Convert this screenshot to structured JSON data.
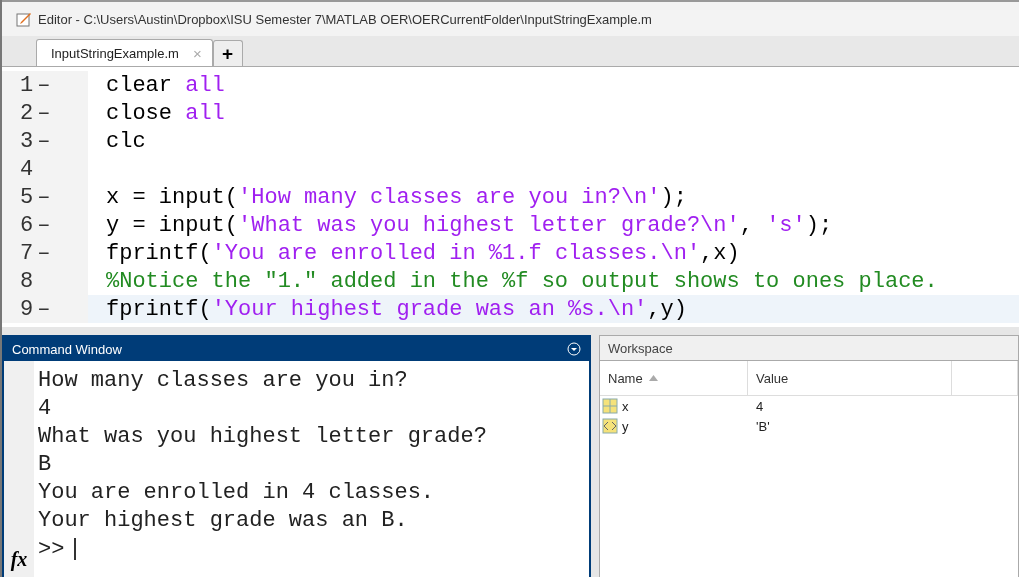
{
  "window": {
    "title": "Editor - C:\\Users\\Austin\\Dropbox\\ISU Semester 7\\MATLAB OER\\OERCurrentFolder\\InputStringExample.m"
  },
  "tabs": [
    {
      "label": "InputStringExample.m",
      "selected": true,
      "close": "×"
    }
  ],
  "new_tab": "+",
  "editor": {
    "lines": [
      {
        "number": "1",
        "marker": "–",
        "current": false,
        "segments": [
          {
            "kind": "plain",
            "text": "clear "
          },
          {
            "kind": "string",
            "text": "all"
          }
        ]
      },
      {
        "number": "2",
        "marker": "–",
        "current": false,
        "segments": [
          {
            "kind": "plain",
            "text": "close "
          },
          {
            "kind": "string",
            "text": "all"
          }
        ]
      },
      {
        "number": "3",
        "marker": "–",
        "current": false,
        "segments": [
          {
            "kind": "plain",
            "text": "clc"
          }
        ]
      },
      {
        "number": "4",
        "current": false
      },
      {
        "number": "5",
        "marker": "–",
        "current": false,
        "segments": [
          {
            "kind": "plain",
            "text": "x = input("
          },
          {
            "kind": "string",
            "text": "'How many classes are you in?\\n'"
          },
          {
            "kind": "plain",
            "text": ");"
          }
        ]
      },
      {
        "number": "6",
        "marker": "–",
        "current": false,
        "segments": [
          {
            "kind": "plain",
            "text": "y = input("
          },
          {
            "kind": "string",
            "text": "'What was you highest letter grade?\\n'"
          },
          {
            "kind": "plain",
            "text": ", "
          },
          {
            "kind": "string",
            "text": "'s'"
          },
          {
            "kind": "plain",
            "text": ");"
          }
        ]
      },
      {
        "number": "7",
        "marker": "–",
        "current": false,
        "segments": [
          {
            "kind": "plain",
            "text": "fprintf("
          },
          {
            "kind": "string",
            "text": "'You are enrolled in %1.f classes.\\n'"
          },
          {
            "kind": "plain",
            "text": ",x)"
          }
        ]
      },
      {
        "number": "8",
        "current": false,
        "segments": [
          {
            "kind": "comment",
            "text": "%Notice the \"1.\" added in the %f so output shows to ones place."
          }
        ]
      },
      {
        "number": "9",
        "marker": "–",
        "current": true,
        "segments": [
          {
            "kind": "plain",
            "text": "fprintf("
          },
          {
            "kind": "string",
            "text": "'Your highest grade was an %s.\\n'"
          },
          {
            "kind": "plain",
            "text": ",y)"
          }
        ]
      }
    ]
  },
  "command_window": {
    "title": "Command Window",
    "output": [
      "How many classes are you in?",
      "4",
      "What was you highest letter grade?",
      "B",
      "You are enrolled in 4 classes.",
      "Your highest grade was an B."
    ],
    "prompt": ">>",
    "function_button": "fx"
  },
  "workspace": {
    "title": "Workspace",
    "columns": [
      "Name",
      "Value"
    ],
    "rows": [
      {
        "name": "x",
        "value": "4",
        "kind": "matrix"
      },
      {
        "name": "y",
        "value": "'B'",
        "kind": "char"
      }
    ]
  }
}
